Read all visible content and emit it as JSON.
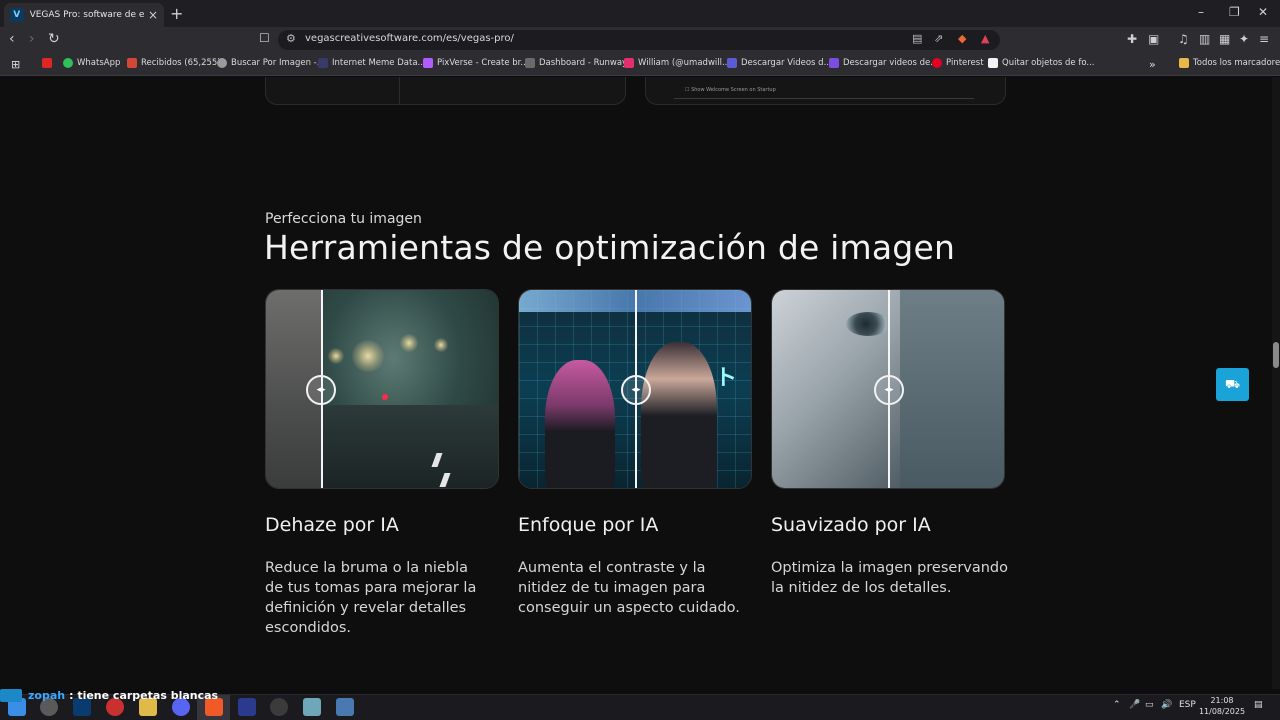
{
  "browser": {
    "tab_title": "VEGAS Pro: software de edición",
    "tab_favicon": "V",
    "url": "vegascreativesoftware.com/es/vegas-pro/",
    "bookmarks": [
      "WhatsApp",
      "Recibidos (65,255)",
      "Buscar Por Imagen -...",
      "Internet Meme Data...",
      "PixVerse - Create br...",
      "Dashboard - Runway",
      "William (@umadwill...",
      "Descargar Videos d...",
      "Descargar videos de...",
      "Pinterest",
      "Quitar objetos de fo..."
    ],
    "all_bookmarks": "Todos los marcadores"
  },
  "page": {
    "startup_checkbox": "Show Welcome Screen on Startup",
    "eyebrow": "Perfecciona tu imagen",
    "heading": "Herramientas de optimización de imagen",
    "cards": [
      {
        "title": "Dehaze por IA",
        "desc": "Reduce la bruma o la niebla de tus tomas para mejorar la definición y revelar detalles escondidos."
      },
      {
        "title": "Enfoque por IA",
        "desc": "Aumenta el contraste y la nitidez de tu imagen para conseguir un aspecto cuidado."
      },
      {
        "title": "Suavizado por IA",
        "desc": "Optimiza la imagen preservando la nitidez de los detalles."
      }
    ]
  },
  "overlay": {
    "user": "zopah",
    "message": ": tiene carpetas blancas"
  },
  "taskbar": {
    "language": "ESP",
    "time": "21:08",
    "date": "11/08/2025"
  },
  "colors": {
    "accent": "#1aa3d9",
    "background": "#0e0e0e"
  }
}
